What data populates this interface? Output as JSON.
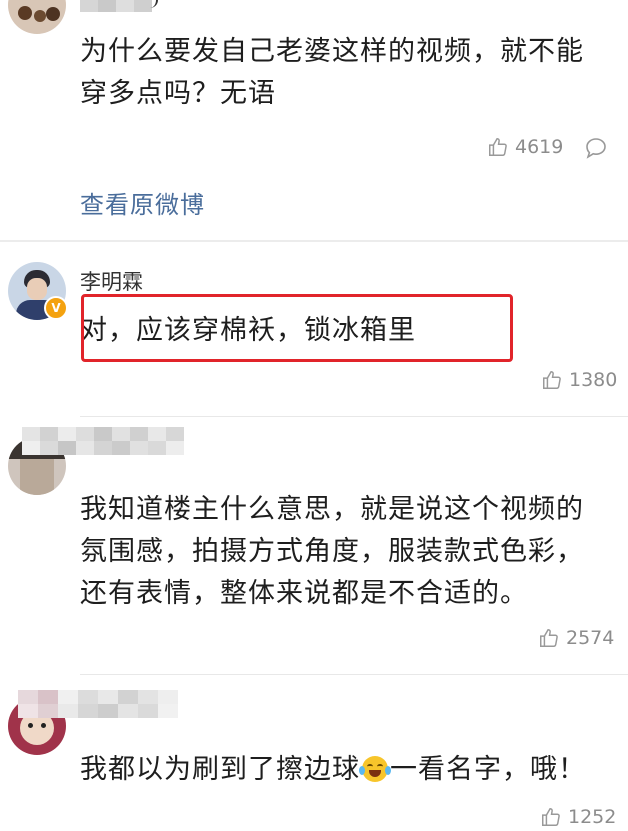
{
  "comments": [
    {
      "author": "",
      "content_lines": [
        "为什么要发自己老婆这样的视频，就不能",
        "穿多点吗？无语"
      ],
      "likes": "4619",
      "link": "查看原微博"
    },
    {
      "author": "李明霖",
      "verified_badge": "V",
      "content_lines": [
        "对，应该穿棉袄，锁冰箱里"
      ],
      "likes": "1380"
    },
    {
      "author": "",
      "content_lines": [
        "我知道楼主什么意思，就是说这个视频的",
        "氛围感，拍摄方式角度，服装款式色彩，",
        "还有表情，整体来说都是不合适的。"
      ],
      "likes": "2574"
    },
    {
      "author": "",
      "content_lines": [
        "我都以为刷到了擦边球",
        "一看名字，哦！"
      ],
      "emoji": "laughing-crying-emoji",
      "likes": "1252"
    }
  ],
  "colors": {
    "link": "#4a6d9b",
    "highlight_box": "#e1242a",
    "badge": "#f4a210",
    "meta_text": "#8c8c8c"
  }
}
